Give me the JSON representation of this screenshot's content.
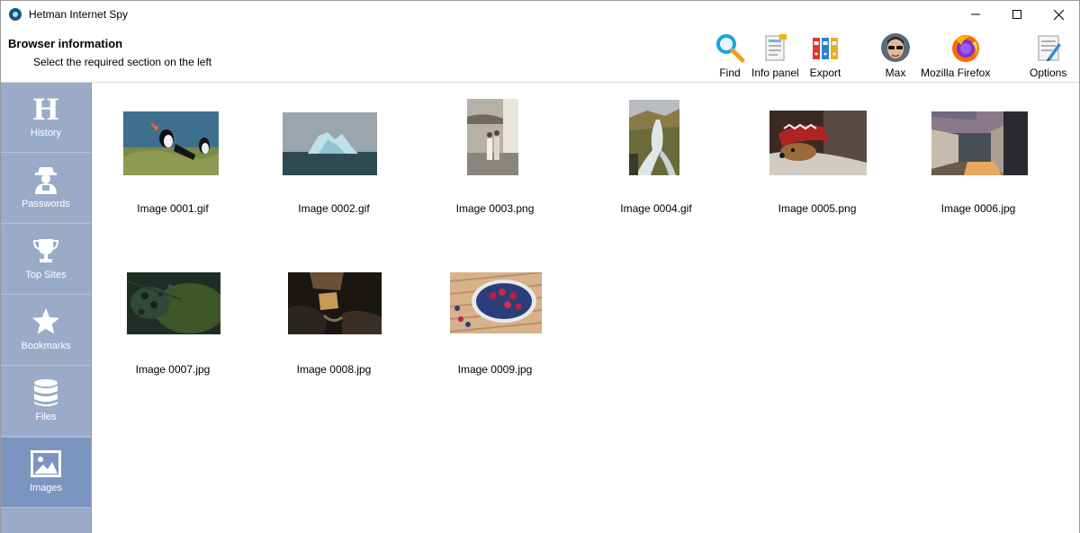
{
  "window": {
    "title": "Hetman Internet Spy"
  },
  "header": {
    "title": "Browser information",
    "subtitle": "Select the required section on the left"
  },
  "toolbar": {
    "find": "Find",
    "info_panel": "Info panel",
    "export": "Export",
    "user": "Max",
    "browser": "Mozilla Firefox",
    "options": "Options"
  },
  "sidebar": {
    "items": [
      {
        "label": "History",
        "icon": "history-icon"
      },
      {
        "label": "Passwords",
        "icon": "passwords-icon"
      },
      {
        "label": "Top Sites",
        "icon": "trophy-icon"
      },
      {
        "label": "Bookmarks",
        "icon": "star-icon"
      },
      {
        "label": "Files",
        "icon": "database-icon"
      },
      {
        "label": "Images",
        "icon": "image-icon",
        "active": true
      }
    ]
  },
  "images": [
    {
      "name": "Image 0001.gif"
    },
    {
      "name": "Image 0002.gif"
    },
    {
      "name": "Image 0003.png"
    },
    {
      "name": "Image 0004.gif"
    },
    {
      "name": "Image 0005.png"
    },
    {
      "name": "Image 0006.jpg"
    },
    {
      "name": "Image 0007.jpg"
    },
    {
      "name": "Image 0008.jpg"
    },
    {
      "name": "Image 0009.jpg"
    }
  ],
  "colors": {
    "sidebar": "#9aabc8",
    "sidebar_active": "#7c94c0",
    "accent": "#1e90ff"
  }
}
